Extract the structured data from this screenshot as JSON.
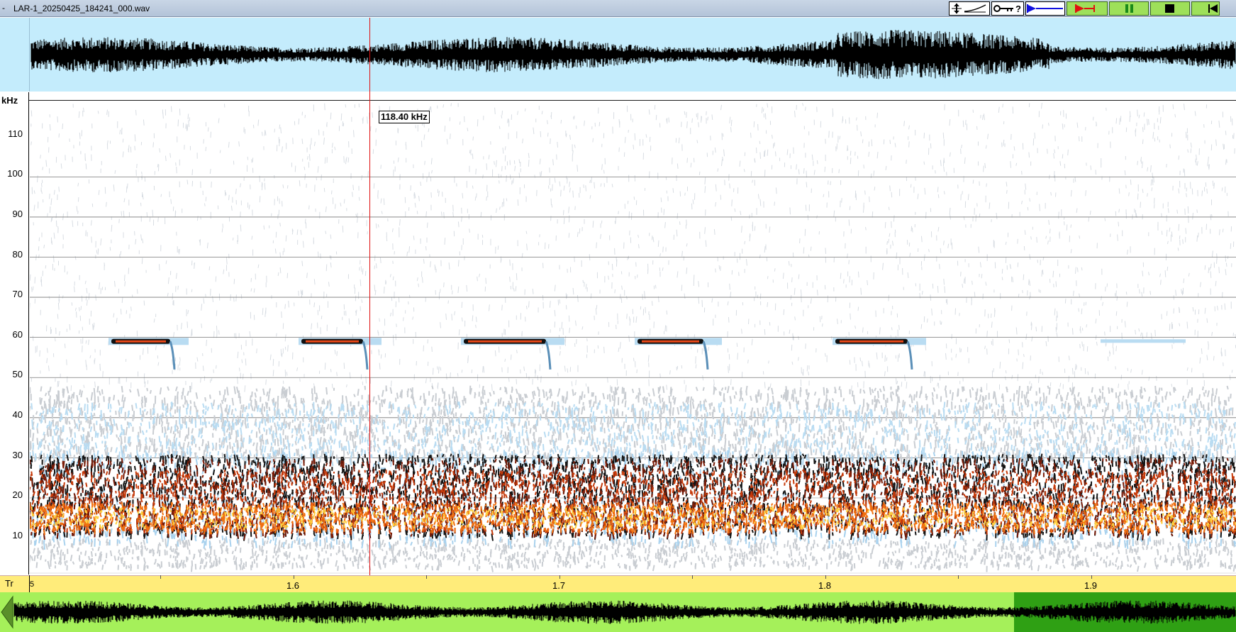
{
  "window": {
    "title": "LAR-1_20250425_184241_000.wav",
    "dash": "-"
  },
  "toolbar": {
    "buttons": [
      {
        "name": "scale-toggle-button",
        "icon": "vertical-scale-icon"
      },
      {
        "name": "key-help-button",
        "icon": "key-question-icon",
        "text": "?"
      },
      {
        "name": "playhead-button",
        "icon": "blue-arrow-line-icon"
      },
      {
        "name": "play-selection-button",
        "icon": "red-play-marker-icon"
      },
      {
        "name": "pause-button",
        "icon": "pause-icon"
      },
      {
        "name": "stop-button",
        "icon": "stop-icon"
      },
      {
        "name": "rewind-button",
        "icon": "rewind-to-start-icon"
      }
    ]
  },
  "freq_axis": {
    "unit_label": "kHz",
    "ticks": [
      "110",
      "100",
      "90",
      "80",
      "70",
      "60",
      "50",
      "40",
      "30",
      "20",
      "10"
    ]
  },
  "cursor": {
    "readout": "118.40 kHz"
  },
  "time_axis": {
    "row_label": "Tr",
    "edge_label": "5",
    "labels": [
      "1.6",
      "1.7",
      "1.8",
      "1.9"
    ]
  },
  "colors": {
    "overview_bg": "#c4ecfc",
    "time_bar_bg": "#ffec7a",
    "navigator_bg": "#a5f05a",
    "navigator_visible": "#2fa014",
    "cursor": "#e01010"
  },
  "calls": {
    "frequency_khz": 59,
    "note": ""
  }
}
